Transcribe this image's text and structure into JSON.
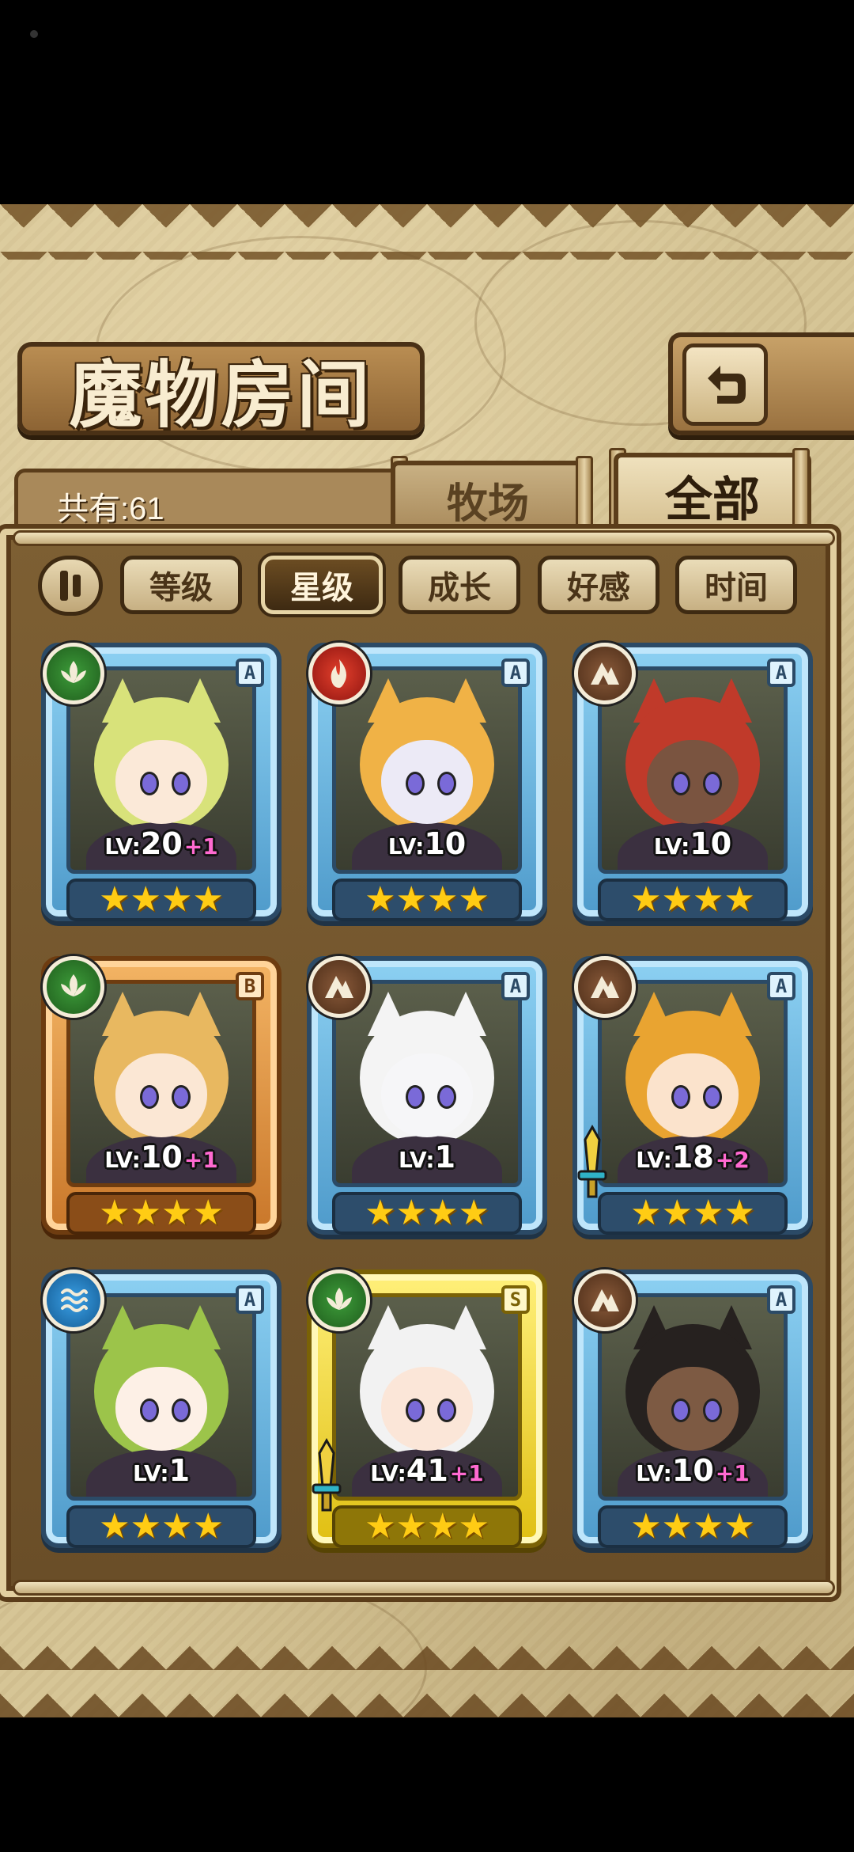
{
  "header": {
    "title": "魔物房间"
  },
  "tabs": {
    "count_label": "共有:61",
    "ranch_label": "牧场",
    "all_label": "全部"
  },
  "filters": [
    {
      "label": "等级",
      "active": false
    },
    {
      "label": "星级",
      "active": true
    },
    {
      "label": "成长",
      "active": false
    },
    {
      "label": "好感",
      "active": false
    },
    {
      "label": "时间",
      "active": false
    }
  ],
  "colors": {
    "nature": "#2f7d2b",
    "fire": "#c62a1c",
    "earth": "#6b4228",
    "water": "#2384c9",
    "rank_A": "#8cd0f2",
    "rank_B": "#f3b464",
    "rank_S": "#fff07a",
    "star": "#ffcc14",
    "bonus": "#ff6ad1"
  },
  "monsters": [
    {
      "element": "nature-icon",
      "rank": "A",
      "level": "20",
      "bonus": "+1",
      "stars": "★★★★",
      "weapon": false,
      "hair": "#d8e27a",
      "skin": "#fbe9d8"
    },
    {
      "element": "fire-icon",
      "rank": "A",
      "level": "10",
      "bonus": "",
      "stars": "★★★★",
      "weapon": false,
      "hair": "#f0b246",
      "skin": "#eceaf6"
    },
    {
      "element": "earth-icon",
      "rank": "A",
      "level": "10",
      "bonus": "",
      "stars": "★★★★",
      "weapon": false,
      "hair": "#c03a2a",
      "skin": "#7a5440"
    },
    {
      "element": "nature-icon",
      "rank": "B",
      "level": "10",
      "bonus": "+1",
      "stars": "★★★★",
      "weapon": false,
      "hair": "#e8b860",
      "skin": "#fbe7d4"
    },
    {
      "element": "earth-icon",
      "rank": "A",
      "level": "1",
      "bonus": "",
      "stars": "★★★★",
      "weapon": false,
      "hair": "#f4f4f4",
      "skin": "#f6f6f8"
    },
    {
      "element": "earth-icon",
      "rank": "A",
      "level": "18",
      "bonus": "+2",
      "stars": "★★★★",
      "weapon": true,
      "hair": "#e9a431",
      "skin": "#fbe3cc"
    },
    {
      "element": "water-icon",
      "rank": "A",
      "level": "1",
      "bonus": "",
      "stars": "★★★★",
      "weapon": false,
      "hair": "#9cc44a",
      "skin": "#fdf0e6"
    },
    {
      "element": "nature-icon",
      "rank": "S",
      "level": "41",
      "bonus": "+1",
      "stars": "★★★★",
      "weapon": true,
      "hair": "#f2f2f2",
      "skin": "#fbe6d8"
    },
    {
      "element": "earth-icon",
      "rank": "A",
      "level": "10",
      "bonus": "+1",
      "stars": "★★★★",
      "weapon": false,
      "hair": "#26211f",
      "skin": "#7d5a43"
    }
  ],
  "level_prefix": "LV:"
}
